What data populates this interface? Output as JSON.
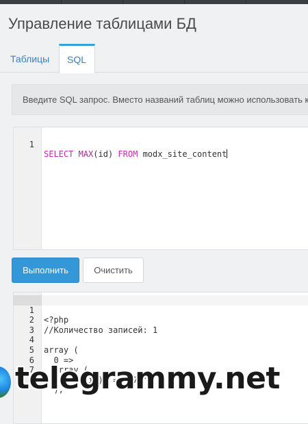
{
  "page": {
    "title": "Управление таблицами БД"
  },
  "tabs": [
    {
      "label": "Таблицы",
      "active": false
    },
    {
      "label": "SQL",
      "active": true
    }
  ],
  "sql": {
    "hint": "Введите SQL запрос. Вместо названий таблиц можно использовать к",
    "editor": {
      "line_number": "1",
      "kw_select": "SELECT",
      "fn_max": "MAX",
      "args": "(id)",
      "kw_from": "FROM",
      "table": "modx_site_content"
    }
  },
  "buttons": {
    "run": "Выполнить",
    "clear": "Очистить"
  },
  "result": {
    "lines": [
      {
        "n": "1",
        "text": "<?php"
      },
      {
        "n": "2",
        "text": "//Количество записей: 1"
      },
      {
        "n": "3",
        "text": ""
      },
      {
        "n": "4",
        "text": "array ("
      },
      {
        "n": "5",
        "text": "  0 =>"
      },
      {
        "n": "6",
        "text": "  array ("
      },
      {
        "n": "7",
        "text": "    'MAX(id)' => '78',"
      },
      {
        "n": "8",
        "text": "  ),"
      }
    ]
  },
  "watermark": {
    "text": "telegrammy.net",
    "icon": "globe-logo-icon"
  },
  "colors": {
    "accent": "#3498d8",
    "tab_border": "#32a3d6",
    "link": "#3a7fbf",
    "keyword": "#c02cae",
    "comment": "#4a8f3c"
  }
}
